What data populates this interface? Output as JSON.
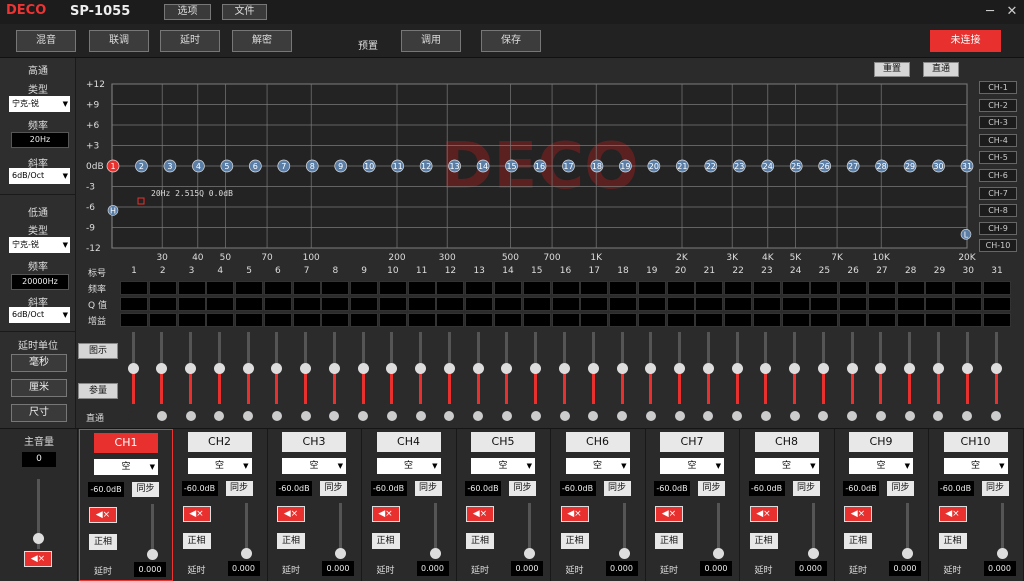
{
  "titlebar": {
    "logo": "DECO",
    "model": "SP-1055",
    "menu_options": "选项",
    "menu_file": "文件",
    "minimize": "─",
    "close": "✕"
  },
  "nav": {
    "buttons": [
      "混音",
      "联调",
      "延时",
      "解密"
    ],
    "preset_label": "预置",
    "recall": "调用",
    "save": "保存",
    "status": "未连接"
  },
  "left": {
    "highpass": {
      "title": "高通",
      "type_label": "类型",
      "type_value": "宁克-锐",
      "freq_label": "频率",
      "freq_value": "20Hz",
      "slope_label": "斜率",
      "slope_value": "6dB/Oct"
    },
    "lowpass": {
      "title": "低通",
      "type_label": "类型",
      "type_value": "宁克-锐",
      "freq_label": "频率",
      "freq_value": "20000Hz",
      "slope_label": "斜率",
      "slope_value": "6dB/Oct"
    },
    "delay_unit": {
      "title": "延时单位",
      "ms": "毫秒",
      "cm": "厘米",
      "size": "尺寸"
    }
  },
  "graph": {
    "reset": "重置",
    "bypass": "直通",
    "y_ticks": [
      "+12",
      "+9",
      "+6",
      "+3",
      "0dB",
      "-3",
      "-6",
      "-9",
      "-12"
    ],
    "freq_ticks": [
      {
        "f": 30,
        "label": "30"
      },
      {
        "f": 40,
        "label": "40"
      },
      {
        "f": 50,
        "label": "50"
      },
      {
        "f": 70,
        "label": "70"
      },
      {
        "f": 100,
        "label": "100"
      },
      {
        "f": 200,
        "label": "200"
      },
      {
        "f": 300,
        "label": "300"
      },
      {
        "f": 500,
        "label": "500"
      },
      {
        "f": 700,
        "label": "700"
      },
      {
        "f": 1000,
        "label": "1K"
      },
      {
        "f": 2000,
        "label": "2K"
      },
      {
        "f": 3000,
        "label": "3K"
      },
      {
        "f": 4000,
        "label": "4K"
      },
      {
        "f": 5000,
        "label": "5K"
      },
      {
        "f": 7000,
        "label": "7K"
      },
      {
        "f": 10000,
        "label": "10K"
      },
      {
        "f": 20000,
        "label": "20K"
      }
    ],
    "point_labels": [
      "1",
      "2",
      "3",
      "4",
      "5",
      "6",
      "7",
      "8",
      "9",
      "10",
      "11",
      "12",
      "13",
      "14",
      "15",
      "16",
      "17",
      "18",
      "19",
      "20",
      "21",
      "22",
      "23",
      "24",
      "25",
      "26",
      "27",
      "28",
      "29",
      "30",
      "31"
    ],
    "hp_marker": "H",
    "lp_marker": "L",
    "info": "20Hz 2.515Q 0.0dB",
    "watermark": "DECO",
    "channels": [
      "CH-1",
      "CH-2",
      "CH-3",
      "CH-4",
      "CH-5",
      "CH-6",
      "CH-7",
      "CH-8",
      "CH-9",
      "CH-10"
    ]
  },
  "table": {
    "row_labels": [
      "标号",
      "频率",
      "Q 值",
      "增益"
    ],
    "numbers": [
      "1",
      "2",
      "3",
      "4",
      "5",
      "6",
      "7",
      "8",
      "9",
      "10",
      "11",
      "12",
      "13",
      "14",
      "15",
      "16",
      "17",
      "18",
      "19",
      "20",
      "21",
      "22",
      "23",
      "24",
      "25",
      "26",
      "27",
      "28",
      "29",
      "30",
      "31"
    ]
  },
  "sliders": {
    "graph_btn": "图示",
    "param_btn": "参量",
    "bypass_label": "直通",
    "levels": [
      0.5,
      0.5,
      0.5,
      0.5,
      0.5,
      0.5,
      0.5,
      0.5,
      0.5,
      0.5,
      0.5,
      0.5,
      0.5,
      0.5,
      0.5,
      0.5,
      0.5,
      0.5,
      0.5,
      0.5,
      0.5,
      0.5,
      0.5,
      0.5,
      0.5,
      0.5,
      0.5,
      0.5,
      0.5,
      0.5,
      0.5
    ]
  },
  "master": {
    "title": "主音量",
    "value": "0"
  },
  "channels": [
    {
      "name": "CH1",
      "input": "空",
      "db": "-60.0dB",
      "sync": "同步",
      "mute": "◀×",
      "phase": "正相",
      "delay_label": "延时",
      "delay": "0.000"
    },
    {
      "name": "CH2",
      "input": "空",
      "db": "-60.0dB",
      "sync": "同步",
      "mute": "◀×",
      "phase": "正相",
      "delay_label": "延时",
      "delay": "0.000"
    },
    {
      "name": "CH3",
      "input": "空",
      "db": "-60.0dB",
      "sync": "同步",
      "mute": "◀×",
      "phase": "正相",
      "delay_label": "延时",
      "delay": "0.000"
    },
    {
      "name": "CH4",
      "input": "空",
      "db": "-60.0dB",
      "sync": "同步",
      "mute": "◀×",
      "phase": "正相",
      "delay_label": "延时",
      "delay": "0.000"
    },
    {
      "name": "CH5",
      "input": "空",
      "db": "-60.0dB",
      "sync": "同步",
      "mute": "◀×",
      "phase": "正相",
      "delay_label": "延时",
      "delay": "0.000"
    },
    {
      "name": "CH6",
      "input": "空",
      "db": "-60.0dB",
      "sync": "同步",
      "mute": "◀×",
      "phase": "正相",
      "delay_label": "延时",
      "delay": "0.000"
    },
    {
      "name": "CH7",
      "input": "空",
      "db": "-60.0dB",
      "sync": "同步",
      "mute": "◀×",
      "phase": "正相",
      "delay_label": "延时",
      "delay": "0.000"
    },
    {
      "name": "CH8",
      "input": "空",
      "db": "-60.0dB",
      "sync": "同步",
      "mute": "◀×",
      "phase": "正相",
      "delay_label": "延时",
      "delay": "0.000"
    },
    {
      "name": "CH9",
      "input": "空",
      "db": "-60.0dB",
      "sync": "同步",
      "mute": "◀×",
      "phase": "正相",
      "delay_label": "延时",
      "delay": "0.000"
    },
    {
      "name": "CH10",
      "input": "空",
      "db": "-60.0dB",
      "sync": "同步",
      "mute": "◀×",
      "phase": "正相",
      "delay_label": "延时",
      "delay": "0.000"
    }
  ],
  "colors": {
    "accent": "#e8302e",
    "point": "#5a7ea6",
    "grid": "#7a7a7a",
    "watermark": "#8a2020"
  }
}
